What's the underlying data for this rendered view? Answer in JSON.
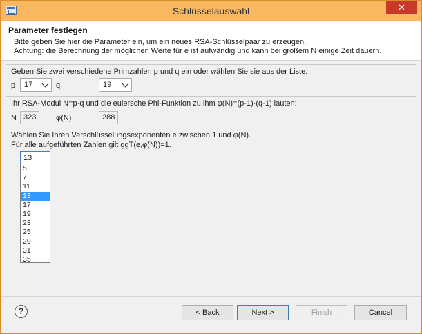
{
  "window": {
    "title": "Schlüsselauswahl",
    "close_glyph": "✕"
  },
  "header": {
    "title": "Parameter festlegen",
    "desc_line1": "Bitte geben Sie hier die Parameter ein, um ein neues RSA-Schlüsselpaar zu erzeugen.",
    "desc_line2": "Achtung: die Berechnung der möglichen Werte für e ist aufwändig und kann bei großem N einige Zeit dauern."
  },
  "primes": {
    "instruction": "Geben Sie zwei verschiedene Primzahlen p und q ein oder wählen Sie sie aus der Liste.",
    "p_label": "p",
    "p_value": "17",
    "q_label": "q",
    "q_value": "19"
  },
  "modulus": {
    "instruction": "Ihr RSA-Modul N=p·q und die eulersche Phi-Funktion zu ihm φ(N)=(p-1)·(q-1) lauten:",
    "n_label": "N",
    "n_value": "323",
    "phi_label": "φ(N)",
    "phi_value": "288"
  },
  "exponent": {
    "instruction_line1": "Wählen Sie Ihren Verschlüsselungsexponenten e zwischen 1 und φ(N).",
    "instruction_line2": "Für alle aufgeführten Zahlen gilt ggT(e,φ(N))=1.",
    "e_value": "13",
    "options": [
      "5",
      "7",
      "11",
      "13",
      "17",
      "19",
      "23",
      "25",
      "29",
      "31",
      "35"
    ],
    "selected": "13"
  },
  "footer": {
    "help_glyph": "?",
    "back_label": "< Back",
    "next_label": "Next >",
    "finish_label": "Finish",
    "cancel_label": "Cancel"
  },
  "colors": {
    "titlebar": "#f9b85f",
    "close": "#c7392b",
    "selection": "#3399ff"
  }
}
